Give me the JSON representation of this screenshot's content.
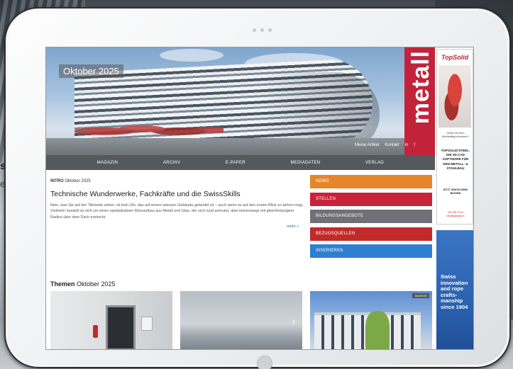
{
  "background": {
    "text_fragment": "s",
    "text_fragment2": "e"
  },
  "hero": {
    "month": "Oktober 2025",
    "brand": "metall",
    "links": [
      "Meine Artikel",
      "Kontakt",
      "in",
      "f"
    ]
  },
  "nav": {
    "items": [
      "MAGAZIN",
      "ARCHIV",
      "E-PAPER",
      "MEDIADATEN",
      "VERLAG"
    ]
  },
  "intro": {
    "tag": "INTRO",
    "tag_date": "Oktober 2025",
    "title": "Technische Wunderwerke, Fachkräfte und die SwissSkills",
    "body": "Nein, was Sie auf der Titelseite sehen, ist kein Ufo, das auf einem weissen Gebäude gelandet ist – auch wenn es auf den ersten Blick so wirken mag. Vielmehr handelt es sich um einen spektakulären Büroaufbau aus Metall und Glas, der sich rund anmutet, aber keineswegs mit gleichmässigem Radius über dem Dach erstreckt.",
    "more": "mehr »"
  },
  "categories": [
    {
      "label": "NEWS",
      "color": "#e6862a"
    },
    {
      "label": "STELLEN",
      "color": "#c9213a"
    },
    {
      "label": "BILDUNGSANGEBOTE",
      "color": "#6e7276"
    },
    {
      "label": "BEZUGSQUELLEN",
      "color": "#c22a2a"
    },
    {
      "label": "INSERIEREN",
      "color": "#2f7fd1"
    }
  ],
  "themes": {
    "title": "Themen",
    "date": "Oktober 2025",
    "tile_badge": "ANZEIGE",
    "chevron": "›"
  },
  "ads": {
    "topsolid_logo": "TopSolid",
    "topsolid_small": "Dürfen wir Ihren Arbeitsalltag erleichtern?",
    "topsolid_headline": "TOPSOLID'STEEL: DIE 3D CAD SOFTWARE FÜR DEN METALL- & STAHLBAU",
    "topsolid_cta": "JETZT GRATIS-DEMO BUCHEN",
    "topsolid_phone": "041 530 70 00 info@topsolid.ch",
    "swiss_text": "Swiss innovation and rope crafts-manship since 1904"
  },
  "tablet": {
    "camera_dots": 3
  }
}
